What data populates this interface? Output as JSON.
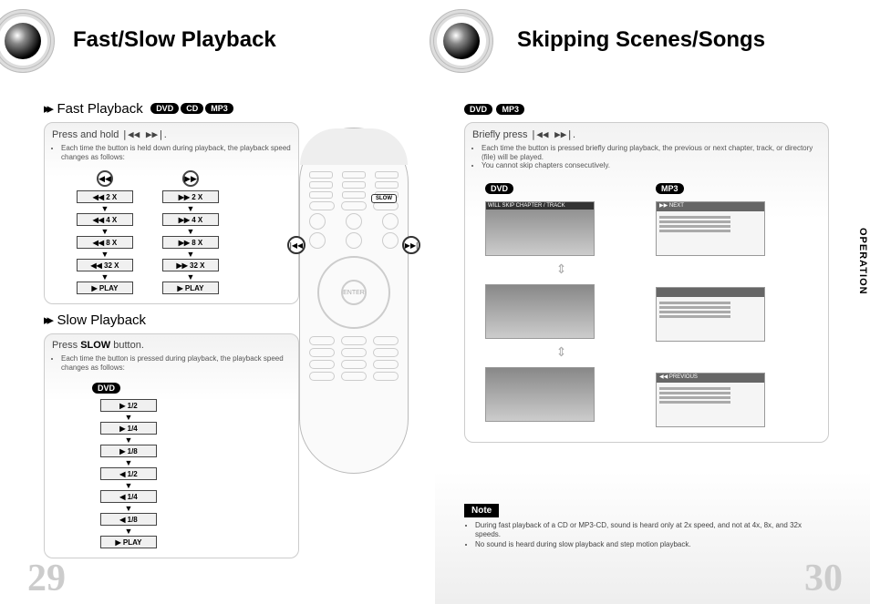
{
  "left_page": {
    "title": "Fast/Slow Playback",
    "page_number": "29",
    "fast": {
      "heading": "Fast Playback",
      "badges": [
        "DVD",
        "CD",
        "MP3"
      ],
      "instr_title_prefix": "Press and hold ",
      "instr_icons": "|◀◀ ▶▶|",
      "bullets": [
        "Each time the button is held down during playback, the playback speed changes as follows:"
      ],
      "rev_icon": "◀◀",
      "fwd_icon": "▶▶",
      "rev_speeds": [
        "◀◀ 2 X",
        "◀◀ 4 X",
        "◀◀ 8 X",
        "◀◀ 32 X",
        "▶ PLAY"
      ],
      "fwd_speeds": [
        "▶▶ 2 X",
        "▶▶ 4 X",
        "▶▶ 8 X",
        "▶▶ 32 X",
        "▶ PLAY"
      ]
    },
    "slow": {
      "heading": "Slow Playback",
      "instr_title_plain": "Press  ",
      "instr_title_bold": "SLOW",
      "instr_title_suffix": " button.",
      "bullets": [
        "Each time the button is pressed during playback, the playback speed changes as follows:"
      ],
      "badge": "DVD",
      "speeds": [
        "▶ 1/2",
        "▶ 1/4",
        "▶ 1/8",
        "◀ 1/2",
        "◀ 1/4",
        "◀ 1/8",
        "▶ PLAY"
      ]
    }
  },
  "remote": {
    "slow_label": "SLOW",
    "enter": "ENTER"
  },
  "right_page": {
    "title": "Skipping Scenes/Songs",
    "page_number": "30",
    "side_tab": "OPERATION",
    "badges": [
      "DVD",
      "MP3"
    ],
    "brief": {
      "instr_title_prefix": "Briefly press ",
      "instr_icons": "|◀◀ ▶▶|",
      "bullets": [
        "Each time the button is pressed briefly during playback, the previous or next chapter, track, or directory (file) will be played.",
        "You cannot skip chapters consecutively."
      ],
      "col_dvd": "DVD",
      "col_mp3": "MP3",
      "dvd_caption": "WILL SKIP CHAPTER / TRACK",
      "mp3_next": "▶▶ NEXT",
      "mp3_prev": "◀◀ PREVIOUS"
    },
    "note": {
      "label": "Note",
      "items": [
        "During fast playback of a CD or MP3-CD, sound is heard only at 2x speed, and not at 4x, 8x, and 32x speeds.",
        "No sound is heard during slow playback and step motion playback."
      ]
    }
  }
}
